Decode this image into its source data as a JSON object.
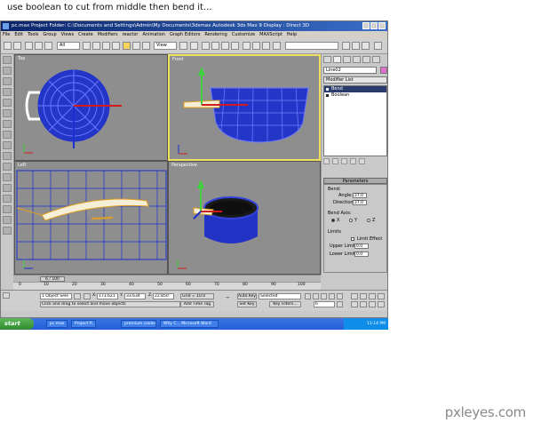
{
  "caption": "use boolean to cut from middle then bend it...",
  "window": {
    "title": "pc.max     Project Folder: C:\\Documents and Settings\\Admin\\My Documents\\3dsmax     Autodesk 3ds Max 9     Display : Direct 3D"
  },
  "menu": [
    "File",
    "Edit",
    "Tools",
    "Group",
    "Views",
    "Create",
    "Modifiers",
    "reactor",
    "Animation",
    "Graph Editors",
    "Rendering",
    "Customize",
    "MAXScript",
    "Help"
  ],
  "toolbar": {
    "selection_filter": "All",
    "reference_coord": "View"
  },
  "viewports": [
    {
      "label": "Top",
      "active": false
    },
    {
      "label": "Front",
      "active": true
    },
    {
      "label": "Left",
      "active": false
    },
    {
      "label": "Perspective",
      "active": false
    }
  ],
  "command_panel": {
    "object_name": "Line02",
    "modifier_list": "Modifier List",
    "stack": [
      {
        "label": "Bend",
        "selected": true
      },
      {
        "label": "Boolean",
        "selected": false
      }
    ],
    "parameters_title": "Parameters",
    "bend_group": "Bend:",
    "angle_label": "Angle:",
    "angle_value": "27.0",
    "direction_label": "Direction:",
    "direction_value": "27.0",
    "bend_axis_group": "Bend Axis:",
    "axes": [
      {
        "label": "X",
        "selected": true
      },
      {
        "label": "Y",
        "selected": false
      },
      {
        "label": "Z",
        "selected": false
      }
    ],
    "limits_group": "Limits",
    "limit_effect_label": "Limit Effect",
    "upper_limit_label": "Upper Limit:",
    "upper_limit_value": "0.0",
    "lower_limit_label": "Lower Limit:",
    "lower_limit_value": "0.0"
  },
  "timeline": {
    "frame_display": "6 / 100",
    "ticks": [
      "0",
      "10",
      "20",
      "30",
      "40",
      "50",
      "60",
      "70",
      "80",
      "90",
      "100"
    ]
  },
  "status": {
    "selection": "1 Object Sele",
    "x_label": "X:",
    "x_value": "173.621",
    "y_label": "Y:",
    "y_value": "33.634",
    "z_label": "Z:",
    "z_value": "22.850",
    "grid": "Grid = 10.0",
    "prompt": "Click and drag to select and move objects",
    "add_time_tag": "Add Time Tag",
    "auto_key": "Auto Key",
    "set_key": "Set Key",
    "key_filters": "Key Filters...",
    "selected_dropdown": "Selected",
    "current_frame": "6"
  },
  "taskbar": {
    "start_label": "start",
    "tasks": [
      "pc.max",
      "Project P...",
      "premium cooler",
      "Why C... Microsoft Word"
    ],
    "clock": "11:14 PM"
  },
  "watermark": "pxleyes.com",
  "colors": {
    "viewport_bg": "#8e8e8e",
    "mesh_blue": "#1c2fd0",
    "active_border": "#f0e060",
    "taskbar_blue": "#245edb"
  }
}
